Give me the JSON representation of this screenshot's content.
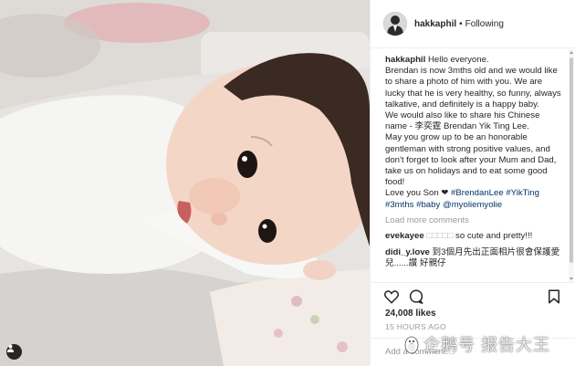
{
  "header": {
    "username": "hakkaphil",
    "dot": "•",
    "follow_status": "Following"
  },
  "caption": {
    "username": "hakkaphil",
    "first_line": "Hello everyone.",
    "line1": "Brendan is now 3mths old and we would like to share a photo of him with you. We are lucky that he is very healthy, so funny, always talkative, and definitely is a happy baby.",
    "line2": "We would also like to share his Chinese name - 李奕霆 Brendan Yik Ting Lee.",
    "line3": "May you grow up to be an honorable gentleman with strong positive values, and don't forget to look after your Mum and Dad, take us on holidays and to eat some good food!",
    "line4_prefix": "Love you Son ❤ ",
    "tags": [
      "#BrendanLee",
      "#YikTing",
      "#3mths",
      "#baby",
      "@myoliemyolie"
    ]
  },
  "load_more": "Load more comments",
  "comments": [
    {
      "username": "evekayee",
      "text": "so cute and pretty!!!"
    },
    {
      "username": "didi_y.love",
      "text": "到3個月先出正面相片很會保護愛兒......讚 好親仔"
    }
  ],
  "likes": "24,008 likes",
  "time_ago": "15 HOURS AGO",
  "add_comment_placeholder": "Add a comment…",
  "watermark": "企鹅号 报告大王",
  "icons": {
    "like": "heart-icon",
    "comment": "comment-bubble-icon",
    "save": "bookmark-icon",
    "user_tag": "person-icon"
  }
}
